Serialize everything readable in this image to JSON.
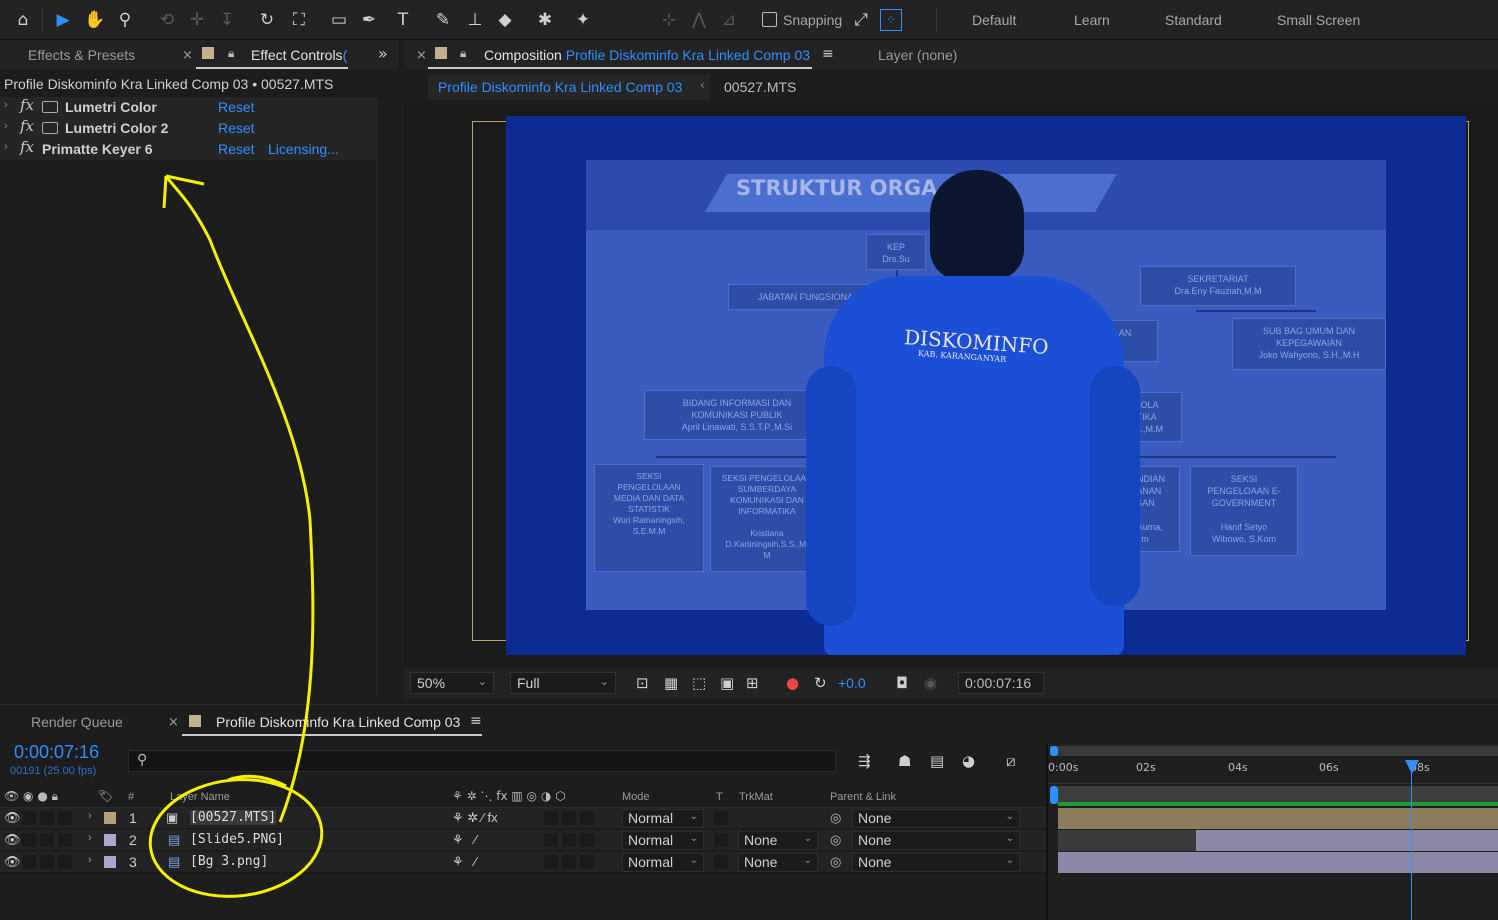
{
  "toolbar": {
    "snapping_label": "Snapping",
    "workspaces": [
      "Default",
      "Learn",
      "Standard",
      "Small Screen"
    ],
    "icons": [
      "home-icon",
      "selection-icon",
      "hand-icon",
      "zoom-icon",
      "orbit-icon",
      "pan-icon",
      "dolly-icon",
      "rotate-icon",
      "pan-behind-icon",
      "rectangle-icon",
      "pen-icon",
      "type-icon",
      "brush-icon",
      "clone-stamp-icon",
      "eraser-icon",
      "roto-brush-icon",
      "puppet-pin-icon"
    ]
  },
  "effects_panel": {
    "tab_presets": "Effects & Presets",
    "tab_controls": "Effect Controls",
    "tab_controls_suffix": "(",
    "expand_glyph": "»",
    "header": "Profile Diskominfo Kra Linked Comp 03 • 00527.MTS",
    "effects": [
      {
        "name": "Lumetri Color",
        "reset": "Reset",
        "licensing": ""
      },
      {
        "name": "Lumetri Color 2",
        "reset": "Reset",
        "licensing": ""
      },
      {
        "name": "Primatte Keyer 6",
        "reset": "Reset",
        "licensing": "Licensing..."
      }
    ]
  },
  "comp_panel": {
    "tab_prefix": "Composition",
    "tab_comp_name": "Profile Diskominfo Kra Linked Comp 03",
    "layer_tab": "Layer",
    "layer_value": "(none)",
    "breadcrumb_comp": "Profile Diskominfo Kra Linked Comp 03",
    "breadcrumb_layer": "00527.MTS",
    "slide": {
      "title": "STRUKTUR ORGA",
      "jacket_text": "DISKOMINFO",
      "jacket_sub": "KAB. KARANGANYAR",
      "boxes": [
        "KEP\nDrs.Su",
        "JABATAN FUNGSIONAL",
        "SEKRETARIAT\nDra.Eny Fauziah,M.M",
        "PERENCANAAN\nUANGAN\nS.H.",
        "SUB BAG UMUM DAN\nKEPEGAWAIAN\nJoko Wahyono, S.H.,M.H",
        "BIDANG INFORMASI DAN\nKOMUNIKASI PUBLIK\nApril Linawati, S.S.T.P.,M.Si",
        "ELOLA\nATIKA\nSos.,M.M",
        "SEKSI\nPENGELOLAAN\nMEDIA DAN DATA\nSTATISTIK\nWuri Ratnaningsih,\nS.E.M.M",
        "SEKSI PENGELOLAAN\nSUMBERDAYA\nKOMUNIKASI DAN\nINFORMATIKA\n\nKristiana\nD.Kartiningsih,S.S.,M.\nM",
        "SANDIAN\nMANAN\nGAN\n\nKusuma,\nm",
        "SEKSI\nPENGELOAAN E-\nGOVERNMENT\n\nHanif Setyo\nWibowo, S.Kom"
      ]
    },
    "zoom": "50%",
    "resolution": "Full",
    "exposure": "+0.0",
    "timecode": "0:00:07:16"
  },
  "timeline": {
    "tab_render": "Render Queue",
    "tab_comp": "Profile Diskominfo Kra Linked Comp 03",
    "current_time": "0:00:07:16",
    "frame_info": "00191 (25.00 fps)",
    "search_placeholder": "",
    "columns": {
      "num": "#",
      "layer_name": "Layer Name",
      "mode": "Mode",
      "t": "T",
      "trkmat": "TrkMat",
      "parent": "Parent & Link"
    },
    "ruler": [
      "0:00s",
      "02s",
      "04s",
      "06s",
      "08s"
    ],
    "layers": [
      {
        "num": "1",
        "name": "[00527.MTS]",
        "mode": "Normal",
        "trkmat": "",
        "parent": "None",
        "color": "#b5a07a"
      },
      {
        "num": "2",
        "name": "[Slide5.PNG]",
        "mode": "Normal",
        "trkmat": "None",
        "parent": "None",
        "color": "#a9a6cf"
      },
      {
        "num": "3",
        "name": "[Bg 3.png]",
        "mode": "Normal",
        "trkmat": "None",
        "parent": "None",
        "color": "#a9a6cf"
      }
    ]
  }
}
